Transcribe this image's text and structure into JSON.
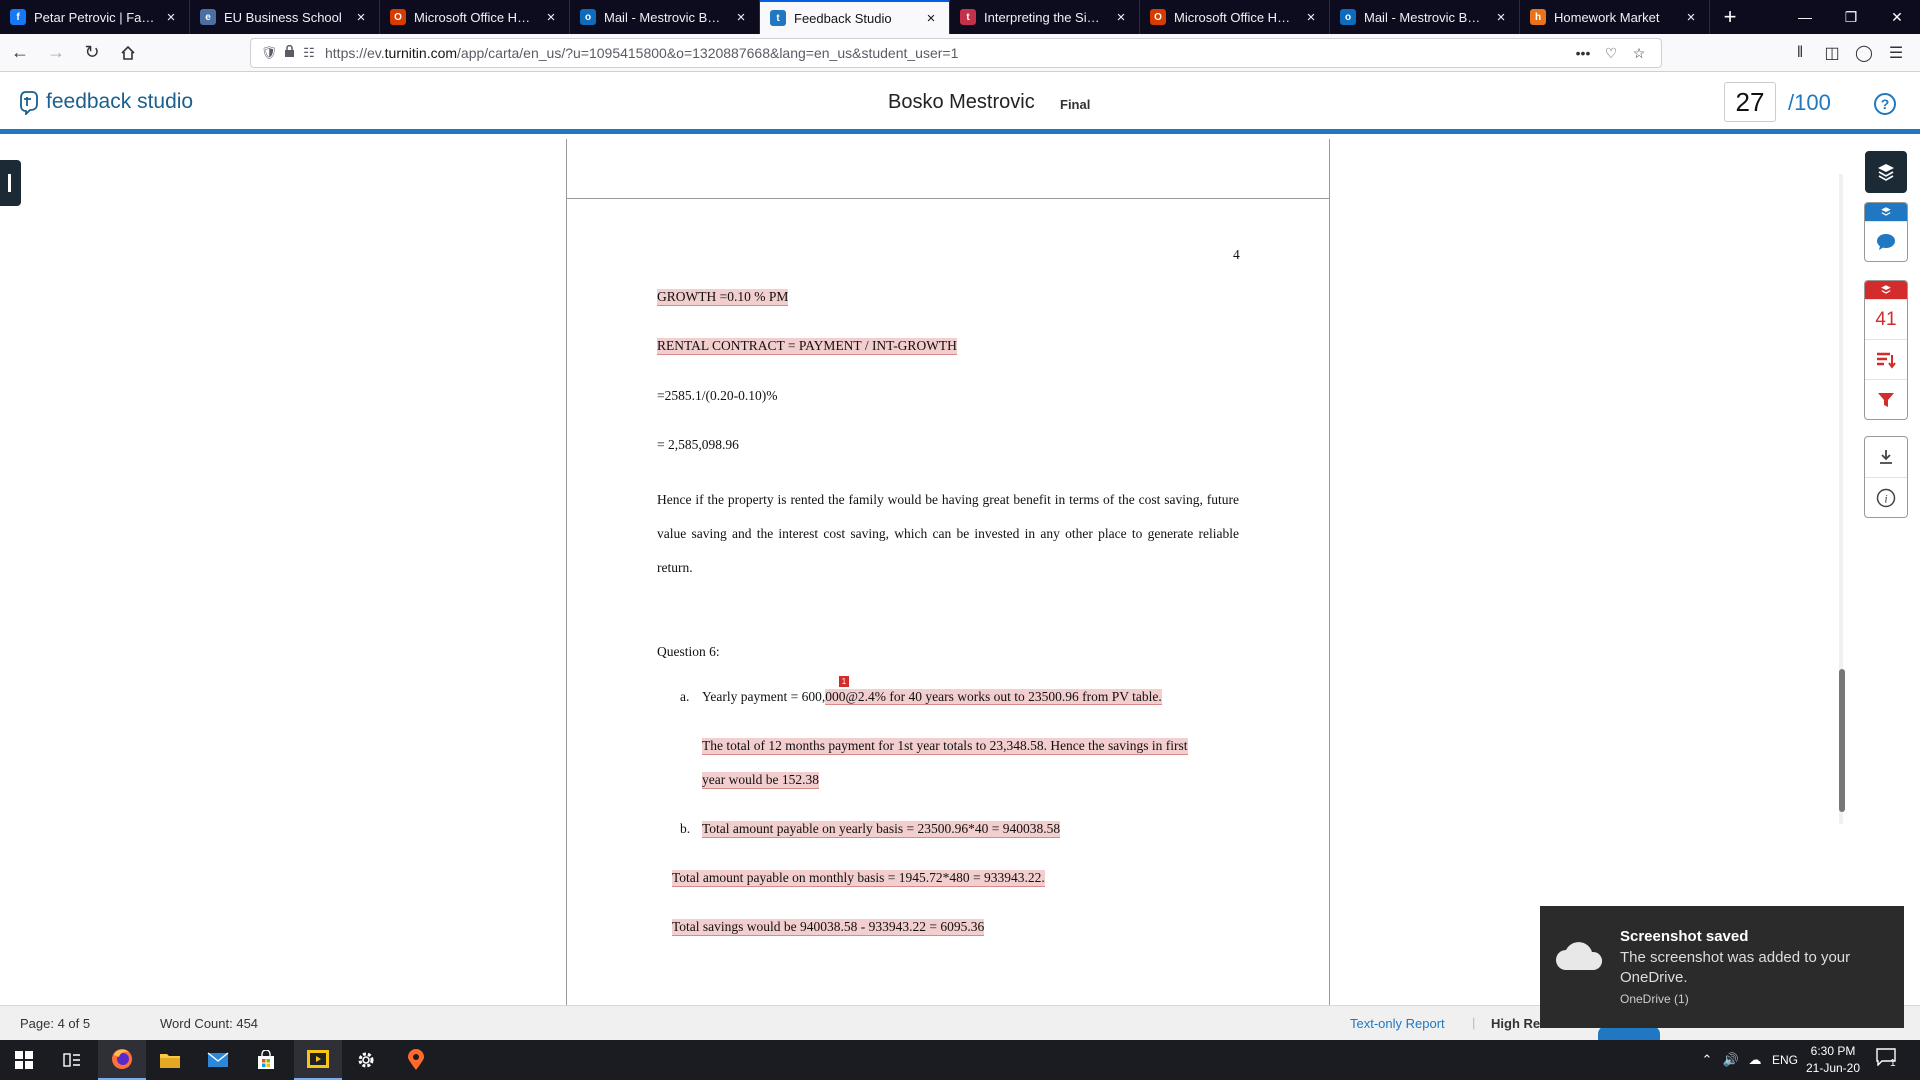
{
  "browser": {
    "tabs": [
      {
        "title": "Petar Petrovic | Facebook",
        "icon": "facebook-icon",
        "color": "#1877f2",
        "glyph": "f"
      },
      {
        "title": "EU Business School",
        "icon": "eu-business-school-icon",
        "color": "#4a6fa0",
        "glyph": "e"
      },
      {
        "title": "Microsoft Office Home",
        "icon": "office-icon",
        "color": "#d83b01",
        "glyph": "O"
      },
      {
        "title": "Mail - Mestrovic Bosko - Outlook",
        "icon": "outlook-icon",
        "color": "#0f6cbd",
        "glyph": "o"
      },
      {
        "title": "Feedback Studio",
        "icon": "turnitin-icon",
        "color": "#1f78c1",
        "glyph": "t"
      },
      {
        "title": "Interpreting the Similarity Report",
        "icon": "turnitin-icon",
        "color": "#c4314b",
        "glyph": "t"
      },
      {
        "title": "Microsoft Office Home",
        "icon": "office-icon",
        "color": "#d83b01",
        "glyph": "O"
      },
      {
        "title": "Mail - Mestrovic Bosko - Outlook",
        "icon": "outlook-icon",
        "color": "#0f6cbd",
        "glyph": "o"
      },
      {
        "title": "Homework Market",
        "icon": "homework-market-icon",
        "color": "#e8731a",
        "glyph": "h"
      }
    ],
    "active_tab_index": 4,
    "url_prefix": "https://ev.",
    "url_domain": "turnitin.com",
    "url_rest": "/app/carta/en_us/?u=1095415800&o=1320887668&lang=en_us&student_user=1"
  },
  "header": {
    "app_name": "feedback studio",
    "student_name": "Bosko Mestrovic",
    "submission_label": "Final",
    "score": "27",
    "score_total": "/100",
    "help": "?"
  },
  "document": {
    "page_number": "4",
    "lines": {
      "growth": "GROWTH =0.10 % PM",
      "rental": "RENTAL CONTRACT = PAYMENT / INT-GROWTH",
      "calc": "=2585.1/(0.20-0.10)%",
      "result": "= 2,585,098.96",
      "paragraph": "Hence if the property is rented the family would be having great benefit in terms of the cost saving, future value saving and the interest cost saving, which can be invested in any other place to generate reliable return.",
      "question": "Question 6:",
      "a_label": "a.",
      "a_pre": "Yearly payment = 600,",
      "a_hl": "000@2.4% for 40 years works out to 23500.96 from PV table.",
      "a2_line1": "The total of 12 months payment for 1st year totals to 23,348.58. Hence the savings in first",
      "a2_line2": "year would be 152.38",
      "b_label": "b.",
      "b_text": "Total amount payable on yearly basis = 23500.96*40 = 940038.58",
      "b2": "Total amount payable on monthly basis = 1945.72*480 = 933943.22.",
      "b3": "Total savings would be 940038.58 - 933943.22 = 6095.36"
    },
    "match_marker": "1"
  },
  "sidebar": {
    "similarity_count": "41"
  },
  "status": {
    "page": "Page: 4 of 5",
    "word_count": "Word Count: 454",
    "text_only": "Text-only Report",
    "high_res": "High Re"
  },
  "toast": {
    "title": "Screenshot saved",
    "body": "The screenshot was added to your OneDrive.",
    "source": "OneDrive (1)"
  },
  "taskbar": {
    "language": "ENG",
    "time": "6:30 PM",
    "date": "21-Jun-20",
    "notification_count": "1"
  }
}
